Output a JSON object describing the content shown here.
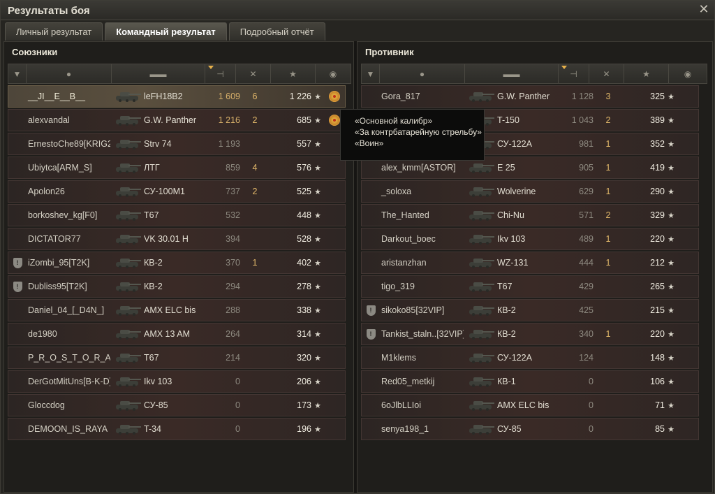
{
  "window": {
    "title": "Результаты боя",
    "close": "✕"
  },
  "tabs": [
    {
      "label": "Личный результат"
    },
    {
      "label": "Командный результат"
    },
    {
      "label": "Подробный отчёт"
    }
  ],
  "allies": {
    "title": "Союзники",
    "rows": [
      {
        "clan": false,
        "name": "__JI__E__B__",
        "tank": "leFH18B2",
        "dmg": "1 609",
        "kills": "6",
        "xp": "1 226",
        "medal": true,
        "me": true,
        "hi": true
      },
      {
        "clan": false,
        "name": "alexvandal",
        "tank": "G.W. Panther",
        "dmg": "1 216",
        "kills": "2",
        "xp": "685",
        "medal": true,
        "me": false,
        "hi": true
      },
      {
        "clan": false,
        "name": "ErnestoChe89[KRIG2]",
        "tank": "Strv 74",
        "dmg": "1 193",
        "kills": "",
        "xp": "557",
        "medal": false
      },
      {
        "clan": false,
        "name": "Ubiytca[ARM_S]",
        "tank": "ЛТГ",
        "dmg": "859",
        "kills": "4",
        "xp": "576",
        "medal": false
      },
      {
        "clan": false,
        "name": "Apolon26",
        "tank": "СУ-100М1",
        "dmg": "737",
        "kills": "2",
        "xp": "525",
        "medal": false
      },
      {
        "clan": false,
        "name": "borkoshev_kg[F0]",
        "tank": "T67",
        "dmg": "532",
        "kills": "",
        "xp": "448",
        "medal": false
      },
      {
        "clan": false,
        "name": "DICTATOR77",
        "tank": "VK 30.01 H",
        "dmg": "394",
        "kills": "",
        "xp": "528",
        "medal": false
      },
      {
        "clan": true,
        "name": "iZombi_95[T2K]",
        "tank": "КВ-2",
        "dmg": "370",
        "kills": "1",
        "xp": "402",
        "medal": false
      },
      {
        "clan": true,
        "name": "Dubliss95[T2K]",
        "tank": "КВ-2",
        "dmg": "294",
        "kills": "",
        "xp": "278",
        "medal": false
      },
      {
        "clan": false,
        "name": "Daniel_04_[_D4N_]",
        "tank": "AMX ELC bis",
        "dmg": "288",
        "kills": "",
        "xp": "338",
        "medal": false
      },
      {
        "clan": false,
        "name": "de1980",
        "tank": "AMX 13 AM",
        "dmg": "264",
        "kills": "",
        "xp": "314",
        "medal": false
      },
      {
        "clan": false,
        "name": "P_R_O_S_T_O_R_A...",
        "tank": "T67",
        "dmg": "214",
        "kills": "",
        "xp": "320",
        "medal": false
      },
      {
        "clan": false,
        "name": "DerGotMitUns[B-K-D]",
        "tank": "Ikv 103",
        "dmg": "0",
        "kills": "",
        "xp": "206",
        "medal": false
      },
      {
        "clan": false,
        "name": "Gloccdog",
        "tank": "СУ-85",
        "dmg": "0",
        "kills": "",
        "xp": "173",
        "medal": false
      },
      {
        "clan": false,
        "name": "DEMOON_IS_RAYA",
        "tank": "T-34",
        "dmg": "0",
        "kills": "",
        "xp": "196",
        "medal": false
      }
    ]
  },
  "enemies": {
    "title": "Противник",
    "rows": [
      {
        "clan": false,
        "name": "Gora_817",
        "tank": "G.W. Panther",
        "dmg": "1 128",
        "kills": "3",
        "xp": "325"
      },
      {
        "clan": false,
        "name": "",
        "tank": "T-150",
        "dmg": "1 043",
        "kills": "2",
        "xp": "389"
      },
      {
        "clan": false,
        "name": "",
        "tank": "СУ-122А",
        "dmg": "981",
        "kills": "1",
        "xp": "352"
      },
      {
        "clan": false,
        "name": "alex_kmm[ASTOR]",
        "tank": "E 25",
        "dmg": "905",
        "kills": "1",
        "xp": "419"
      },
      {
        "clan": false,
        "name": "_soloxa",
        "tank": "Wolverine",
        "dmg": "629",
        "kills": "1",
        "xp": "290"
      },
      {
        "clan": false,
        "name": "The_Hanted",
        "tank": "Chi-Nu",
        "dmg": "571",
        "kills": "2",
        "xp": "329"
      },
      {
        "clan": false,
        "name": "Darkout_boec",
        "tank": "Ikv 103",
        "dmg": "489",
        "kills": "1",
        "xp": "220"
      },
      {
        "clan": false,
        "name": "aristanzhan",
        "tank": "WZ-131",
        "dmg": "444",
        "kills": "1",
        "xp": "212"
      },
      {
        "clan": false,
        "name": "tigo_319",
        "tank": "T67",
        "dmg": "429",
        "kills": "",
        "xp": "265"
      },
      {
        "clan": true,
        "name": "sikoko85[32VIP]",
        "tank": "КВ-2",
        "dmg": "425",
        "kills": "",
        "xp": "215"
      },
      {
        "clan": true,
        "name": "Tankist_staln..[32VIP]",
        "tank": "КВ-2",
        "dmg": "340",
        "kills": "1",
        "xp": "220"
      },
      {
        "clan": false,
        "name": "M1klems",
        "tank": "СУ-122А",
        "dmg": "124",
        "kills": "",
        "xp": "148"
      },
      {
        "clan": false,
        "name": "Red05_metkij",
        "tank": "КВ-1",
        "dmg": "0",
        "kills": "",
        "xp": "106"
      },
      {
        "clan": false,
        "name": "6oJlbLLIoi",
        "tank": "AMX ELC bis",
        "dmg": "0",
        "kills": "",
        "xp": "71"
      },
      {
        "clan": false,
        "name": "senya198_1",
        "tank": "СУ-85",
        "dmg": "0",
        "kills": "",
        "xp": "85"
      }
    ]
  },
  "tooltip": {
    "lines": [
      "«Основной калибр»",
      "«За контрбатарейную стрельбу»",
      "«Воин»"
    ]
  },
  "icons": {
    "star": "★",
    "medal": "medal-icon",
    "clan": "clan-shield-icon"
  }
}
